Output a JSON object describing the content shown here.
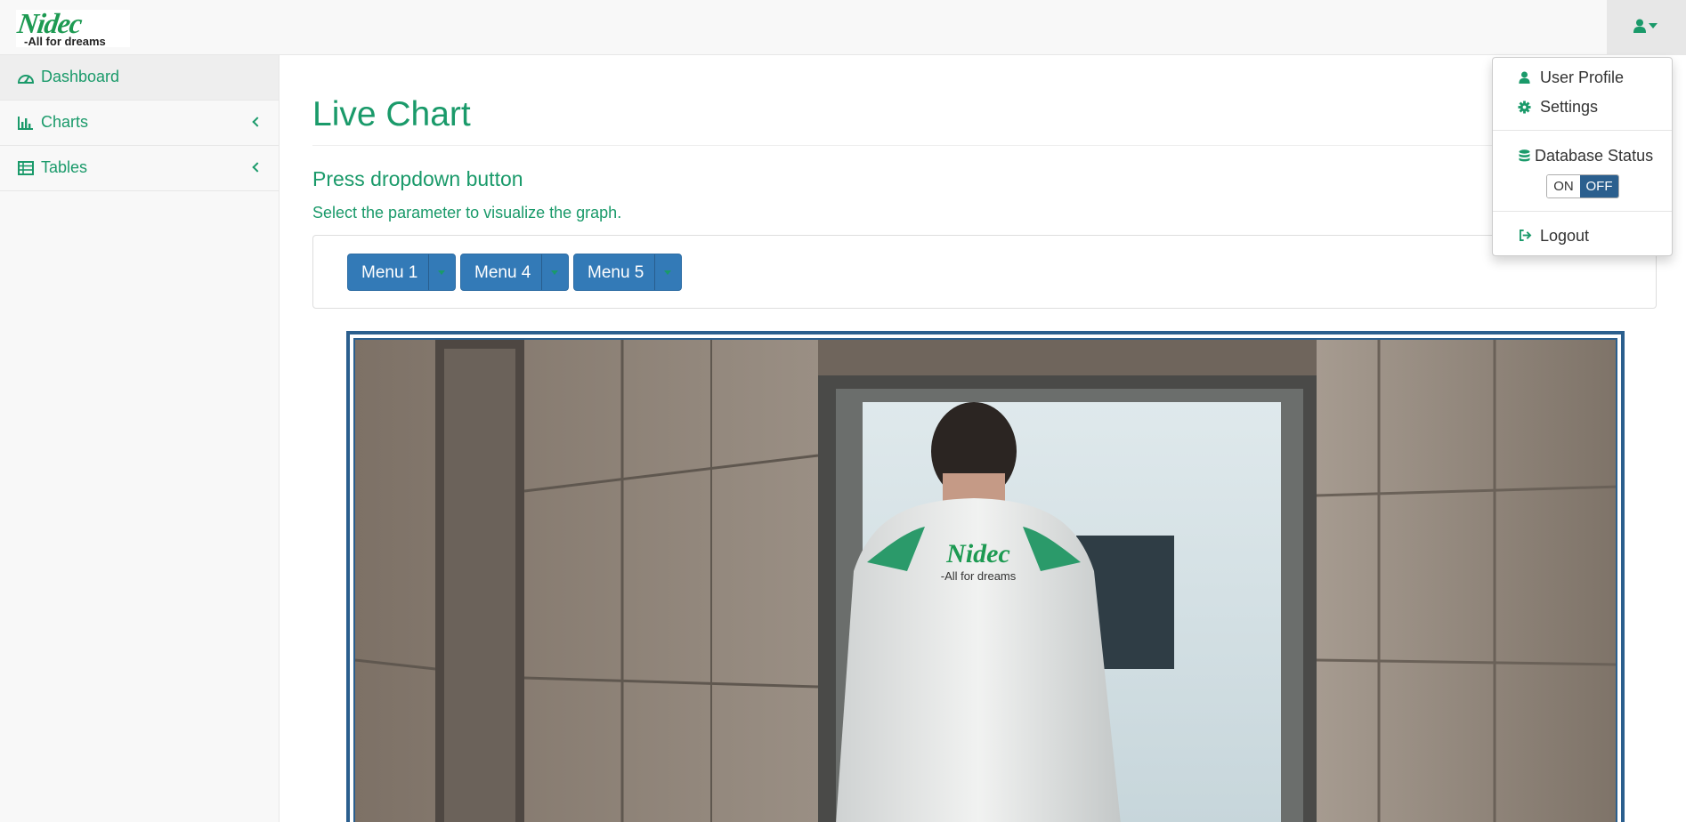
{
  "brand": {
    "logo_text": "Nidec",
    "tagline": "-All for dreams"
  },
  "header": {
    "user_menu_icon": "user-icon"
  },
  "sidebar": {
    "items": [
      {
        "label": "Dashboard",
        "icon": "dashboard-icon",
        "active": true
      },
      {
        "label": "Charts",
        "icon": "bar-chart-icon",
        "expandable": true
      },
      {
        "label": "Tables",
        "icon": "table-icon",
        "expandable": true
      }
    ]
  },
  "main": {
    "title": "Live Chart",
    "subtitle": "Press dropdown button",
    "instructions": "Select the parameter to visualize the graph.",
    "buttons": [
      {
        "label": "Menu 1"
      },
      {
        "label": "Menu 4"
      },
      {
        "label": "Menu 5"
      }
    ],
    "video": {
      "jacket_logo": "Nidec",
      "jacket_tagline": "-All for dreams"
    }
  },
  "user_menu": {
    "items": [
      {
        "label": "User Profile",
        "icon": "user-icon"
      },
      {
        "label": "Settings",
        "icon": "gear-icon"
      },
      {
        "label": "Database Status",
        "icon": "database-icon"
      },
      {
        "label": "Logout",
        "icon": "sign-out-icon"
      }
    ],
    "db_toggle": {
      "on_label": "ON",
      "off_label": "OFF",
      "state": "OFF"
    }
  },
  "colors": {
    "accent": "#1a9a6a",
    "primary_button": "#337ab7",
    "frame": "#2b5f8e",
    "navbar_bg": "#f8f8f8"
  }
}
